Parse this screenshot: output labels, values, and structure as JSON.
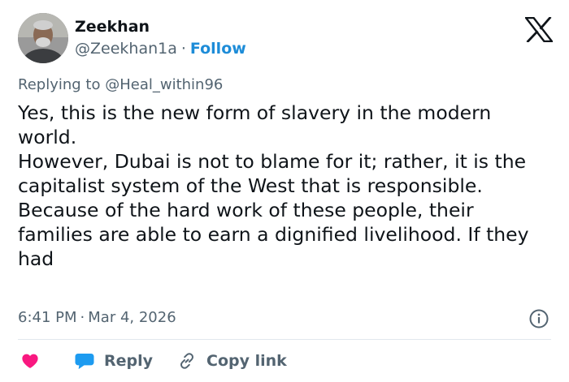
{
  "author": {
    "name": "Zeekhan",
    "handle": "@Zeekhan1a",
    "separator": "·",
    "follow_label": "Follow"
  },
  "reply_context": {
    "prefix": "Replying to",
    "mention": "@Heal_within96"
  },
  "tweet": {
    "paragraphs": [
      "Yes, this is the new form of slavery in the modern world.",
      "However, Dubai is not to blame for it; rather, it is the capitalist system of the West that is responsible.",
      "Because of the hard work of these people, their families are able to earn a dignified livelihood. If they had"
    ]
  },
  "meta": {
    "time": "6:41 PM",
    "separator": "·",
    "date": "Mar 4, 2026"
  },
  "actions": {
    "like_icon": "heart-icon",
    "reply_label": "Reply",
    "reply_icon": "speech-bubble-icon",
    "copy_link_label": "Copy link",
    "copy_link_icon": "link-icon"
  },
  "icons": {
    "brand": "x-logo-icon",
    "info": "info-icon"
  },
  "colors": {
    "text": "#0f1419",
    "secondary": "#536471",
    "follow": "#1d8cd8",
    "heart": "#f91880",
    "reply_bubble": "#1d9bf0",
    "divider": "#e1e8ed"
  }
}
